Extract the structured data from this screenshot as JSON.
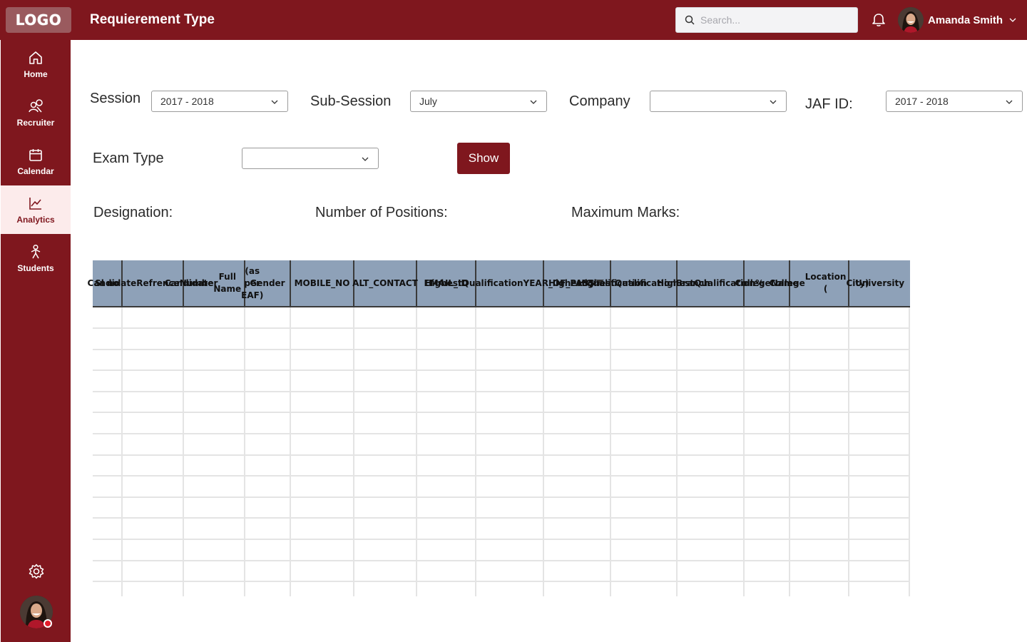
{
  "header": {
    "logo_text": "LOGO",
    "title": "Requierement Type",
    "search_placeholder": "Search...",
    "user_name": "Amanda Smith"
  },
  "sidebar": {
    "items": [
      {
        "label": "Home",
        "icon": "home-icon"
      },
      {
        "label": "Recruiter",
        "icon": "recruiter-icon"
      },
      {
        "label": "Calendar",
        "icon": "calendar-icon"
      },
      {
        "label": "Analytics",
        "icon": "analytics-icon",
        "active": true
      },
      {
        "label": "Students",
        "icon": "students-icon"
      }
    ],
    "settings_icon": "gear-icon"
  },
  "filters": {
    "session_label": "Session",
    "session_value": "2017 - 2018",
    "subsession_label": "Sub-Session",
    "subsession_value": "July",
    "company_label": "Company",
    "company_value": "",
    "jaf_label": "JAF ID:",
    "jaf_value": "2017 - 2018",
    "exam_type_label": "Exam Type",
    "exam_type_value": "",
    "show_label": "Show"
  },
  "info": {
    "designation_label": "Designation:",
    "positions_label": "Number of Positions:",
    "max_marks_label": "Maximum Marks:"
  },
  "table": {
    "columns": [
      [
        "Sl no"
      ],
      [
        "Candidate",
        "Refrence",
        "Number"
      ],
      [
        "Candidate",
        "Full Name",
        "(as per EAF)"
      ],
      [
        "Gender"
      ],
      [
        "MOBILE_NO"
      ],
      [
        "ALT_CONTAC",
        "T"
      ],
      [
        "EMAIL_ID"
      ],
      [
        "Highest",
        "Qualification",
        "YEAR_OF_PAS",
        "S"
      ],
      [
        "Highest",
        "Qualifica",
        "tion"
      ],
      [
        "Highest",
        "Qualification",
        "Branch"
      ],
      [
        "Highest",
        "Qualification",
        "%"
      ],
      [
        "College",
        "Name"
      ],
      [
        "College",
        "Location (",
        "City)"
      ],
      [
        "University"
      ]
    ]
  },
  "colors": {
    "primary": "#7f171e",
    "header_fill": "#8ea1b8",
    "active_bg": "#fcebeb"
  }
}
